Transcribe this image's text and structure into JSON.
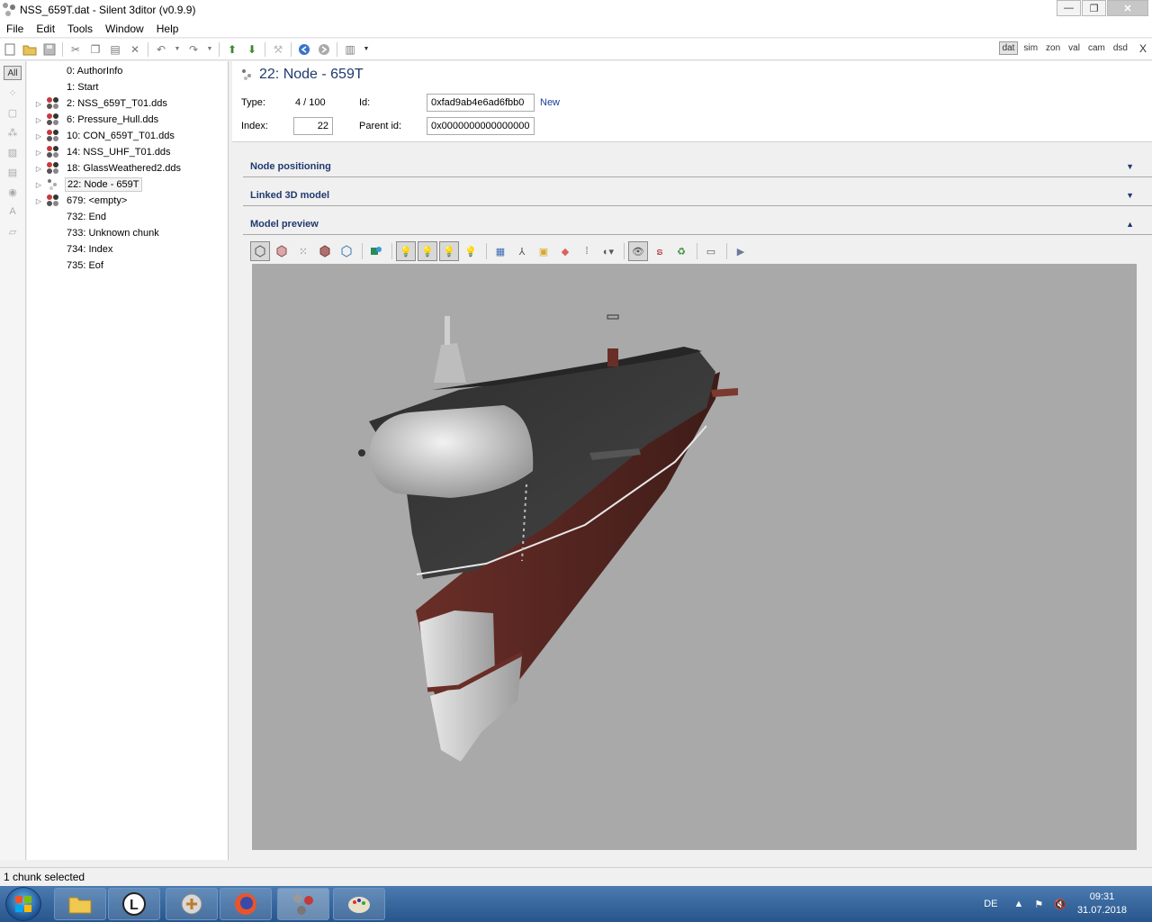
{
  "window": {
    "title": "NSS_659T.dat - Silent 3ditor (v0.9.9)",
    "minimize": "—",
    "maximize": "❐",
    "close": "✕"
  },
  "menu": [
    "File",
    "Edit",
    "Tools",
    "Window",
    "Help"
  ],
  "view_toggles": {
    "dat": "dat",
    "sim": "sim",
    "zon": "zon",
    "val": "val",
    "cam": "cam",
    "dsd": "dsd",
    "close": "X"
  },
  "left_strip": {
    "all": "All"
  },
  "tree": [
    {
      "label": "0: AuthorInfo",
      "expander": "",
      "icon": "none"
    },
    {
      "label": "1: Start",
      "expander": "",
      "icon": "none"
    },
    {
      "label": "2: NSS_659T_T01.dds",
      "expander": "▷",
      "icon": "texture"
    },
    {
      "label": "6: Pressure_Hull.dds",
      "expander": "▷",
      "icon": "texture"
    },
    {
      "label": "10: CON_659T_T01.dds",
      "expander": "▷",
      "icon": "texture"
    },
    {
      "label": "14: NSS_UHF_T01.dds",
      "expander": "▷",
      "icon": "texture"
    },
    {
      "label": "18: GlassWeathered2.dds",
      "expander": "▷",
      "icon": "texture"
    },
    {
      "label": "22: Node - 659T",
      "expander": "▷",
      "icon": "node"
    },
    {
      "label": "679: <empty>",
      "expander": "▷",
      "icon": "texture"
    },
    {
      "label": "732: End",
      "expander": "",
      "icon": "none"
    },
    {
      "label": "733: Unknown chunk",
      "expander": "",
      "icon": "none"
    },
    {
      "label": "734: Index",
      "expander": "",
      "icon": "none"
    },
    {
      "label": "735: Eof",
      "expander": "",
      "icon": "none"
    }
  ],
  "node": {
    "title": "22: Node - 659T",
    "type_label": "Type:",
    "type_value": "4 / 100",
    "id_label": "Id:",
    "id_value": "0xfad9ab4e6ad6fbb0",
    "new_link": "New",
    "index_label": "Index:",
    "index_value": "22",
    "parent_label": "Parent id:",
    "parent_value": "0x0000000000000000"
  },
  "sections": {
    "positioning": "Node positioning",
    "linked": "Linked 3D model",
    "preview": "Model preview"
  },
  "colors": {
    "accent": "#1f3a6e",
    "viewport": "#a9a9a9",
    "hull_dark": "#3a3a3a",
    "hull_red": "#5a2a24"
  },
  "status": {
    "text": "1 chunk selected"
  },
  "tray": {
    "lang": "DE",
    "time": "09:31",
    "date": "31.07.2018"
  }
}
